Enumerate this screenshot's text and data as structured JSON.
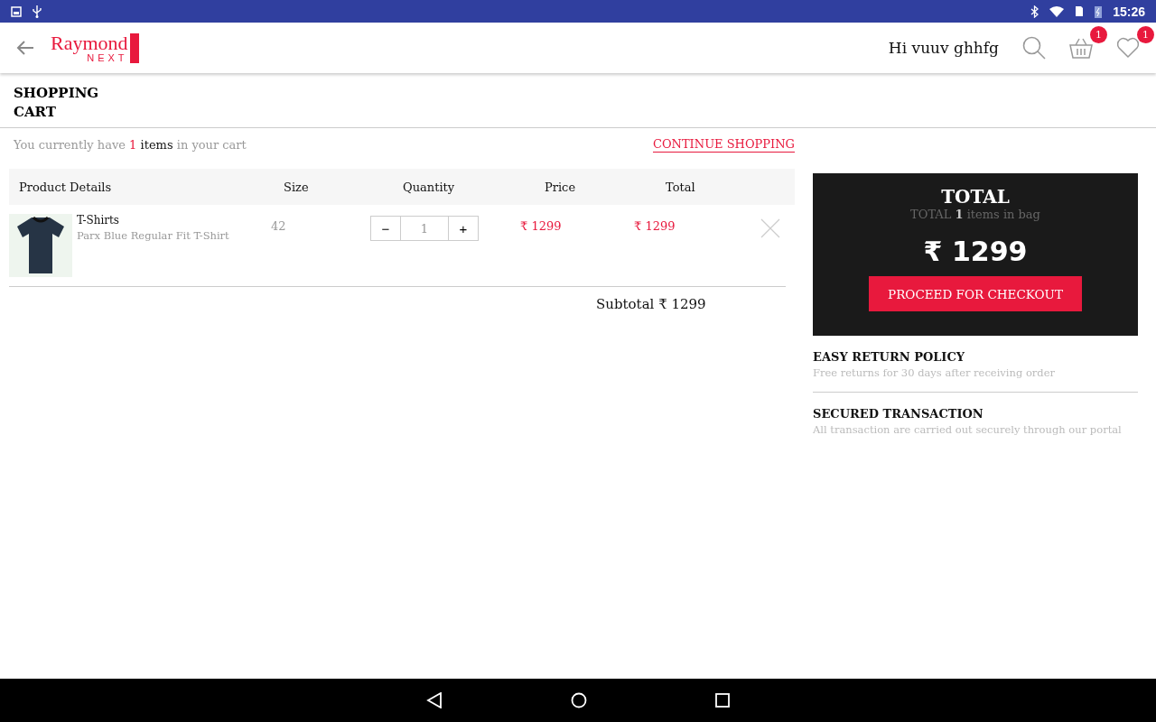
{
  "status_bar": {
    "time": "15:26"
  },
  "header": {
    "logo_top": "Raymond",
    "logo_bottom": "NEXT",
    "greeting": "Hi vuuv ghhfg",
    "cart_count": "1",
    "wishlist_count": "1"
  },
  "page_title": "SHOPPING CART",
  "summary": {
    "prefix": "You currently have",
    "count": "1",
    "word": "items",
    "suffix": "in your cart",
    "link": "CONTINUE SHOPPING"
  },
  "table": {
    "columns": [
      "Product Details",
      "Size",
      "Quantity",
      "Price",
      "Total"
    ],
    "rows": [
      {
        "category": "T-Shirts",
        "name": "Parx Blue Regular Fit T-Shirt",
        "size": "42",
        "quantity": "1",
        "minus": "−",
        "plus": "+",
        "price": "₹ 1299",
        "total": "₹ 1299"
      }
    ],
    "subtotal": "Subtotal ₹ 1299"
  },
  "total_box": {
    "title": "TOTAL",
    "items_line": "TOTAL **1** items in bag",
    "amount": "₹ 1299",
    "button": "PROCEED FOR CHECKOUT"
  },
  "policies": [
    {
      "title": "EASY RETURN POLICY",
      "text": "Free returns for 30 days after receiving order"
    },
    {
      "title": "SECURED TRANSACTION",
      "text": "All transaction are carried out securely through our portal"
    }
  ]
}
